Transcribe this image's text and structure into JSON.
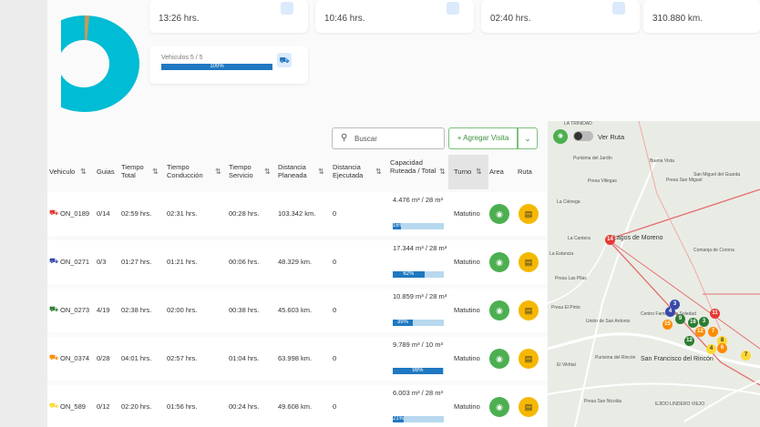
{
  "summary": {
    "cards": [
      {
        "value": "13:26 hrs."
      },
      {
        "value": "10:46 hrs."
      },
      {
        "value": "02:40 hrs."
      },
      {
        "value": "310.880 km."
      }
    ],
    "vehicles": {
      "label": "Vehiculos 5 / 5",
      "progress_text": "100%",
      "progress": 1.0
    }
  },
  "toolbar": {
    "search_placeholder": "Buscar",
    "add_visit_label": "+ Agregar Visita",
    "dropdown_icon": "chevron-down-icon"
  },
  "table": {
    "headers": {
      "vehiculo": "Vehiculo",
      "guias": "Guias",
      "tiempo_total": "Tiempo Total",
      "tiempo_conduccion": "Tiempo Conducción",
      "tiempo_servicio": "Tiempo Servicio",
      "distancia_planeada": "Distancia Planeada",
      "distancia_ejecutada": "Distancia Ejecutada",
      "capacidad": "Capacidad Ruteada / Total",
      "turno": "Turno",
      "area": "Area",
      "ruta": "Ruta"
    },
    "rows": [
      {
        "vehicle": "ON_0189",
        "color": "#e53935",
        "guias": "0/14",
        "total": "02:59 hrs.",
        "conduccion": "02:31 hrs.",
        "servicio": "00:28 hrs.",
        "planeada": "103.342 km.",
        "ejecutada": "0",
        "capacidad": "4.476 m³ / 28 m³",
        "cap_pct": "16%",
        "cap_fraction": 0.16,
        "turno": "Matutino"
      },
      {
        "vehicle": "ON_0271",
        "color": "#3949ab",
        "guias": "0/3",
        "total": "01:27 hrs.",
        "conduccion": "01:21 hrs.",
        "servicio": "00:06 hrs.",
        "planeada": "48.329 km.",
        "ejecutada": "0",
        "capacidad": "17.344 m³ / 28 m³",
        "cap_pct": "62%",
        "cap_fraction": 0.62,
        "turno": "Matutino"
      },
      {
        "vehicle": "ON_0273",
        "color": "#2e7d32",
        "guias": "4/19",
        "total": "02:38 hrs.",
        "conduccion": "02:00 hrs.",
        "servicio": "00:38 hrs.",
        "planeada": "45.603 km.",
        "ejecutada": "0",
        "capacidad": "10.859 m³ / 28 m³",
        "cap_pct": "39%",
        "cap_fraction": 0.39,
        "turno": "Matutino"
      },
      {
        "vehicle": "ON_0374",
        "color": "#fb8c00",
        "guias": "0/28",
        "total": "04:01 hrs.",
        "conduccion": "02:57 hrs.",
        "servicio": "01:04 hrs.",
        "planeada": "63.998 km.",
        "ejecutada": "0",
        "capacidad": "9.789 m³ / 10 m³",
        "cap_pct": "98%",
        "cap_fraction": 0.98,
        "turno": "Matutino"
      },
      {
        "vehicle": "ON_589",
        "color": "#fdd835",
        "guias": "0/12",
        "total": "02:20 hrs.",
        "conduccion": "01:56 hrs.",
        "servicio": "00:24 hrs.",
        "planeada": "49.608 km.",
        "ejecutada": "0",
        "capacidad": "6.003 m³ / 28 m³",
        "cap_pct": "21%",
        "cap_fraction": 0.21,
        "turno": "Matutino"
      }
    ]
  },
  "map": {
    "toggle_label": "Ver Ruta",
    "places": [
      "LA TRINIDAD",
      "Purisima del Jardín",
      "Presa Villegas",
      "La Ciénega",
      "Buena Vista",
      "Presa San Miguel",
      "San Miguel del Guarda",
      "Lagos de Moreno",
      "Comanja de Corona",
      "La Cantera",
      "La Estancia",
      "Presa Las Pilas",
      "Presa El Pinto",
      "Unión de San Antonio",
      "Centro Familiar La Soledad",
      "Purisima del Rincón",
      "San Francisco del Rincón",
      "El Vikhtal",
      "Presa San Nicolás",
      "EJIDO LINDERO VIEJO"
    ],
    "city_labels": [
      "Lagos de Moreno",
      "San Francisco del Rincón"
    ],
    "markers": [
      {
        "label": "14",
        "color": "#e53935"
      },
      {
        "label": "3",
        "color": "#3949ab"
      },
      {
        "label": "4",
        "color": "#3949ab"
      },
      {
        "label": "9",
        "color": "#2e7d32"
      },
      {
        "label": "11",
        "color": "#e53935"
      },
      {
        "label": "16",
        "color": "#2e7d32"
      },
      {
        "label": "3",
        "color": "#2e7d32"
      },
      {
        "label": "15",
        "color": "#fb8c00"
      },
      {
        "label": "12",
        "color": "#fb8c00"
      },
      {
        "label": "7",
        "color": "#fb8c00"
      },
      {
        "label": "8",
        "color": "#fdd835"
      },
      {
        "label": "4",
        "color": "#fdd835"
      },
      {
        "label": "6",
        "color": "#fb8c00"
      },
      {
        "label": "12",
        "color": "#2e7d32"
      },
      {
        "label": "7",
        "color": "#fdd835"
      }
    ]
  }
}
